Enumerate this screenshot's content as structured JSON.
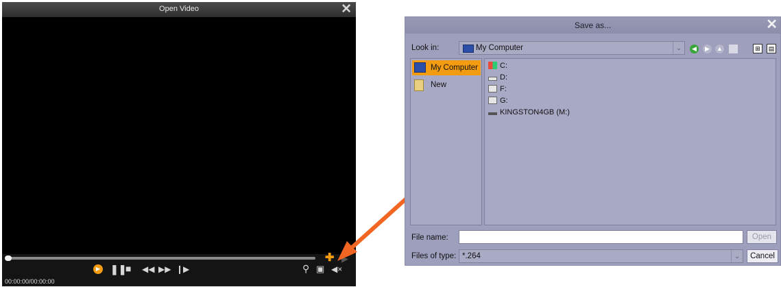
{
  "video_window": {
    "title": "Open Video",
    "time": "00:00:00/00:00:00",
    "seek_progress": 0.0
  },
  "save_dialog": {
    "title": "Save as...",
    "look_in_label": "Look in:",
    "look_in_value": "My Computer",
    "places": [
      {
        "label": "My Computer",
        "selected": true
      },
      {
        "label": "New",
        "selected": false
      }
    ],
    "files": [
      {
        "label": "C:"
      },
      {
        "label": "D:"
      },
      {
        "label": "F:"
      },
      {
        "label": "G:"
      },
      {
        "label": "KINGSTON4GB (M:)"
      }
    ],
    "file_name_label": "File name:",
    "file_name_value": "",
    "open_button": "Open",
    "files_of_type_label": "Files of type:",
    "files_of_type_value": "*.264",
    "cancel_button": "Cancel"
  },
  "colors": {
    "accent_orange": "#f39c12",
    "dialog_bg": "#9d9fbc",
    "arrow": "#f26522"
  }
}
